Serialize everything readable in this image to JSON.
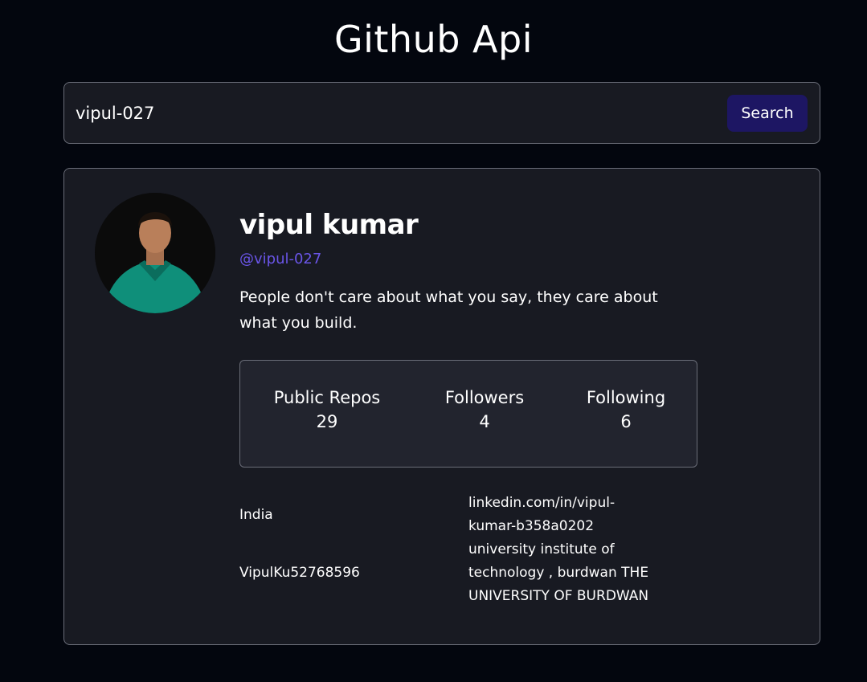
{
  "app": {
    "title": "Github Api"
  },
  "search": {
    "value": "vipul-027",
    "button_label": "Search"
  },
  "profile": {
    "name": "vipul kumar",
    "login": "@vipul-027",
    "bio": "People don't care about what you say, they care about what you build.",
    "stats": [
      {
        "label": "Public Repos",
        "value": "29"
      },
      {
        "label": "Followers",
        "value": "4"
      },
      {
        "label": "Following",
        "value": "6"
      }
    ],
    "location": "India",
    "blog": "linkedin.com/in/vipul-kumar-b358a0202",
    "twitter": "VipulKu52768596",
    "company": "university institute of technology , burdwan THE UNIVERSITY OF BURDWAN"
  },
  "colors": {
    "background": "#03060e",
    "card": "#181a22",
    "accent_login": "#6a55e8",
    "button": "#1d1663"
  }
}
